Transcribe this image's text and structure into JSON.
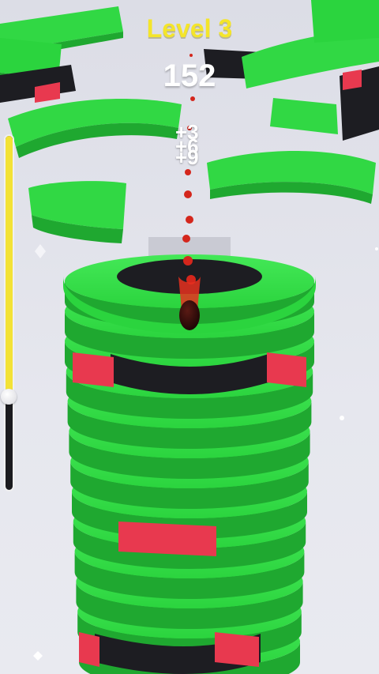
{
  "hud": {
    "level_label": "Level 3",
    "score": "152"
  },
  "popups": [
    "+3",
    "+6",
    "+9"
  ],
  "progress": {
    "fraction": 0.74
  },
  "colors": {
    "safe": "#27d53a",
    "safe_dark": "#1fa830",
    "danger": "#e8394f",
    "black": "#1d1d22",
    "ball": "#2a0d0d",
    "trail": "#d4261c",
    "level_text": "#f4e52a"
  },
  "icons": [
    "ball-icon"
  ]
}
